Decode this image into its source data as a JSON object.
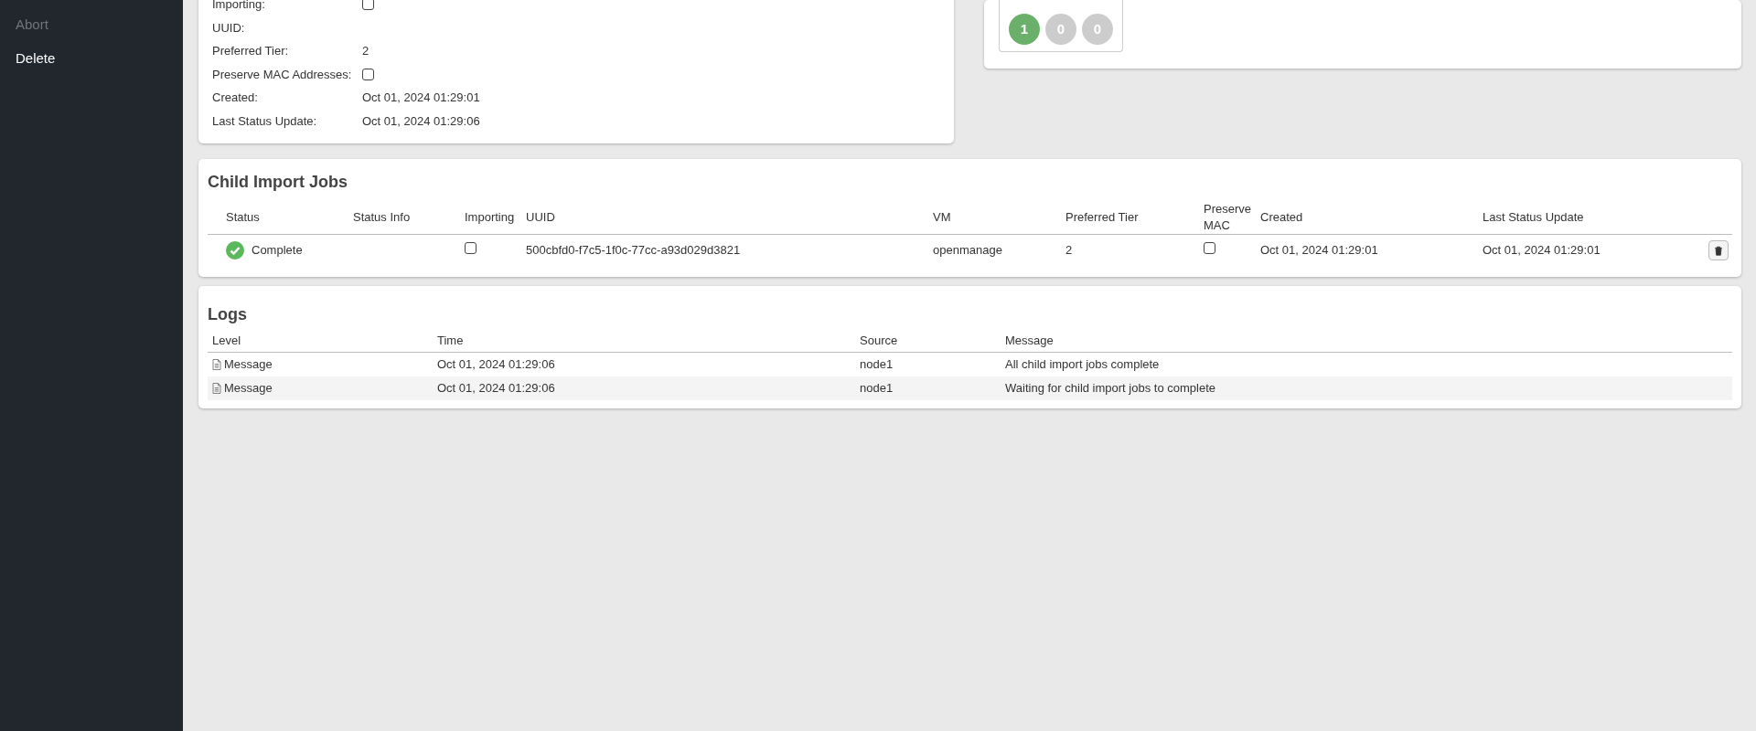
{
  "sidebar": {
    "items": [
      {
        "label": "Abort",
        "disabled": true
      },
      {
        "label": "Delete",
        "disabled": false
      }
    ]
  },
  "details": {
    "rows": [
      {
        "label": "Importing:",
        "kind": "checkbox",
        "checked": false
      },
      {
        "label": "UUID:",
        "kind": "text"
      },
      {
        "label": "Preferred Tier:",
        "kind": "text",
        "value": "2"
      },
      {
        "label": "Preserve MAC Addresses:",
        "kind": "checkbox",
        "checked": false
      },
      {
        "label": "Created:",
        "kind": "text",
        "value": "Oct 01, 2024 01:29:01"
      },
      {
        "label": "Last Status Update:",
        "kind": "text",
        "value": "Oct 01, 2024 01:29:06"
      }
    ]
  },
  "counters": [
    {
      "count": "1",
      "color": "#6aaf6a"
    },
    {
      "count": "0",
      "color": "#cccccc"
    },
    {
      "count": "0",
      "color": "#cccccc"
    }
  ],
  "child_jobs": {
    "title": "Child Import Jobs",
    "columns": [
      "Status",
      "Status Info",
      "Importing",
      "UUID",
      "VM",
      "Preferred Tier",
      "Preserve MAC",
      "Created",
      "Last Status Update"
    ],
    "rows": [
      {
        "status": "Complete",
        "kind": "complete",
        "importing": false,
        "uuid": "500cbfd0-f7c5-1f0c-77cc-a93d029d3821",
        "vm": "openmanage",
        "preferred_tier": "2",
        "preserve_mac": false,
        "created": "Oct 01, 2024 01:29:01",
        "last_status_update": "Oct 01, 2024 01:29:01"
      }
    ]
  },
  "logs": {
    "title": "Logs",
    "columns": [
      "Level",
      "Time",
      "Source",
      "Message"
    ],
    "rows": [
      {
        "level": "Message",
        "time": "Oct 01, 2024 01:29:06",
        "source": "node1",
        "message": "All child import jobs complete"
      },
      {
        "level": "Message",
        "time": "Oct 01, 2024 01:29:06",
        "source": "node1",
        "message": "Waiting for child import jobs to complete"
      }
    ]
  }
}
